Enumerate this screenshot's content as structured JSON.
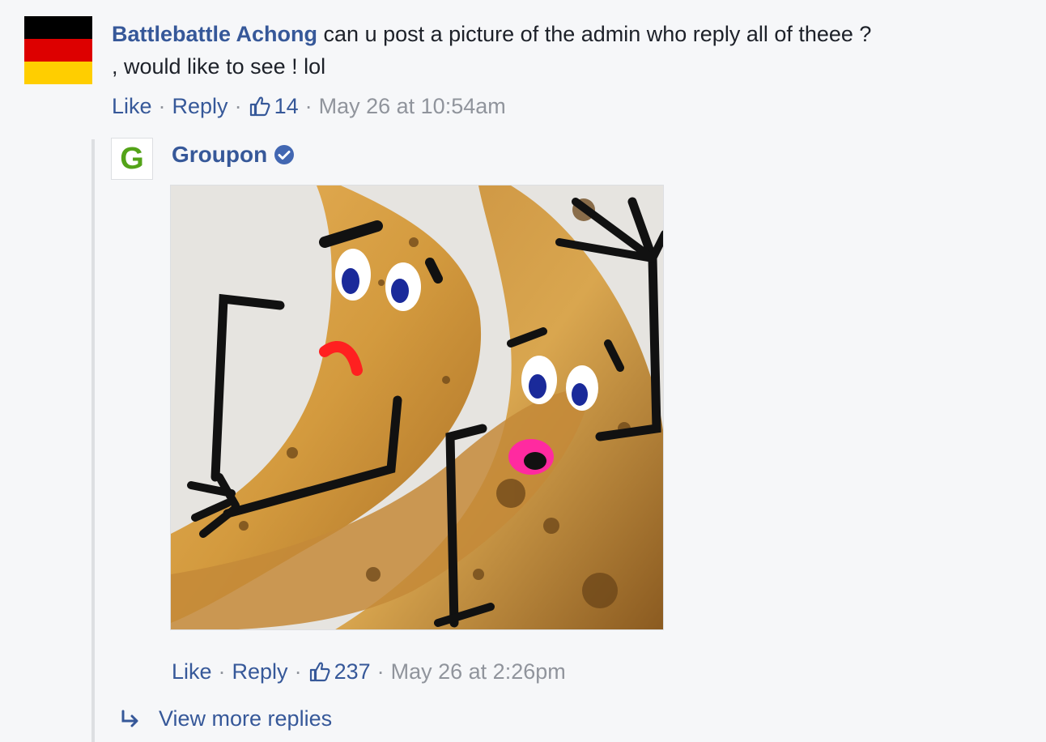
{
  "comment": {
    "author": "Battlebattle Achong",
    "text_line1": "can u post a picture of the admin who reply all of theee ?",
    "text_line2": ", would like to see ! lol",
    "actions": {
      "like": "Like",
      "reply": "Reply",
      "likes_count": "14",
      "timestamp": "May 26 at 10:54am"
    },
    "avatar": {
      "type": "flag",
      "colors": [
        "#000000",
        "#dd0000",
        "#ffce00"
      ]
    }
  },
  "reply": {
    "author": "Groupon",
    "avatar_letter": "G",
    "verified_icon": "verified-badge-icon",
    "photo_description_icon": "banana-drawing",
    "actions": {
      "like": "Like",
      "reply": "Reply",
      "likes_count": "237",
      "timestamp": "May 26 at 2:26pm"
    }
  },
  "view_more_replies": "View more replies",
  "colors": {
    "link": "#365899",
    "meta": "#90949c",
    "background": "#f6f7f9",
    "groupon_green": "#53a318",
    "verified_blue": "#4267b2"
  }
}
